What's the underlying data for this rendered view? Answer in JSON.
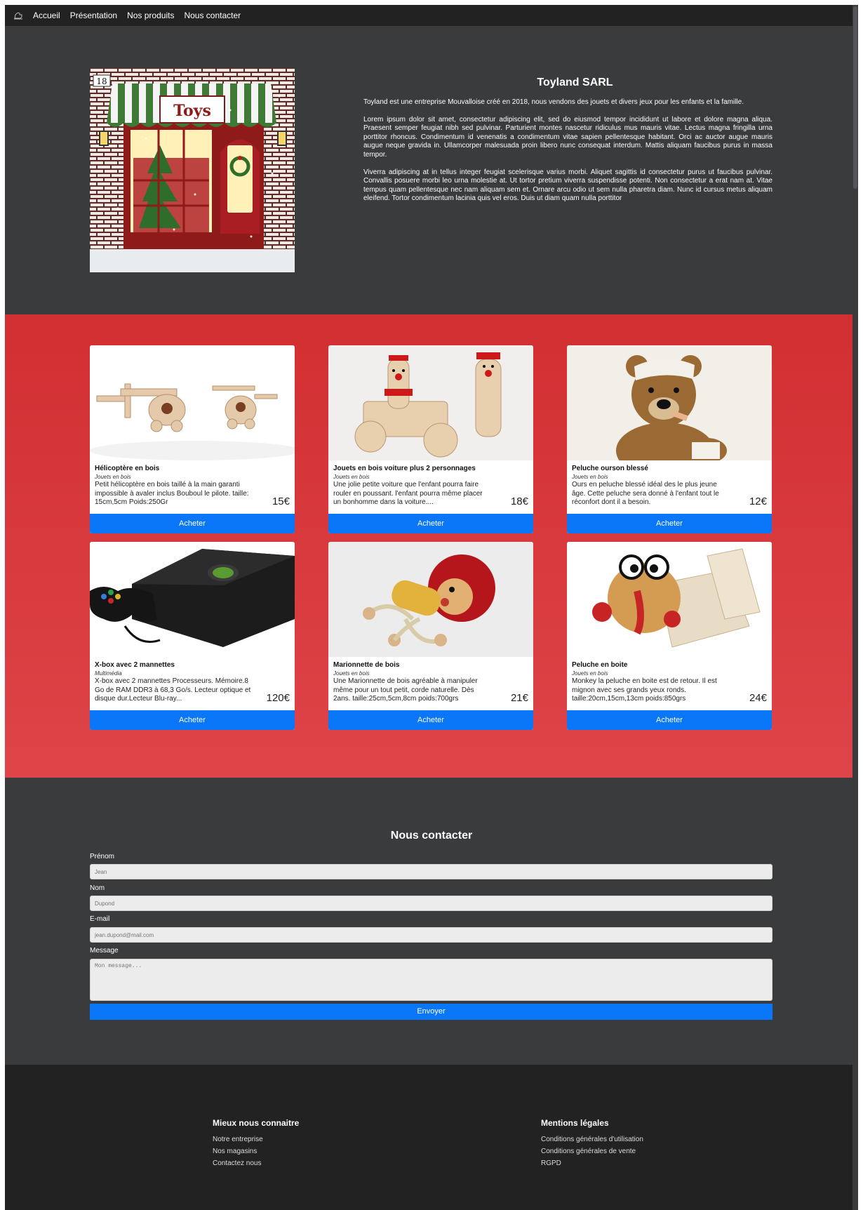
{
  "nav": {
    "logo_icon": "toy-horse-icon",
    "links": [
      "Accueil",
      "Présentation",
      "Nos produits",
      "Nous contacter"
    ]
  },
  "hero": {
    "sign_text": "Toys",
    "calendar_day": "18",
    "title": "Toyland SARL",
    "intro": "Toyland est une entreprise Mouvalloise créé en 2018, nous vendons des jouets et divers jeux pour les enfants et la famille.",
    "p1": "Lorem ipsum dolor sit amet, consectetur adipiscing elit, sed do eiusmod tempor incididunt ut labore et dolore magna aliqua. Praesent semper feugiat nibh sed pulvinar. Parturient montes nascetur ridiculus mus mauris vitae. Lectus magna fringilla urna porttitor rhoncus. Condimentum id venenatis a condimentum vitae sapien pellentesque habitant. Orci ac auctor augue mauris augue neque gravida in. Ullamcorper malesuada proin libero nunc consequat interdum. Mattis aliquam faucibus purus in massa tempor.",
    "p2": "Viverra adipiscing at in tellus integer feugiat scelerisque varius morbi. Aliquet sagittis id consectetur purus ut faucibus pulvinar. Convallis posuere morbi leo urna molestie at. Ut tortor pretium viverra suspendisse potenti. Non consectetur a erat nam at. Vitae tempus quam pellentesque nec nam aliquam sem et. Ornare arcu odio ut sem nulla pharetra diam. Nunc id cursus metus aliquam eleifend. Tortor condimentum lacinia quis vel eros. Duis ut diam quam nulla porttitor"
  },
  "products": [
    {
      "title": "Hélicoptère en bois",
      "category": "Jouets en bois",
      "desc": "Petit hélicoptère en bois taillé à la main garanti impossible à avaler inclus Bouboul le pilote. taille: 15cm,5cm Poids:250Gr",
      "price": "15€",
      "button": "Acheter"
    },
    {
      "title": "Jouets en bois voiture plus 2 personnages",
      "category": "Jouets en bois",
      "desc": "Une jolie petite voiture que l'enfant pourra faire rouler en poussant. l'enfant pourra même placer un bonhomme dans la voiture....",
      "price": "18€",
      "button": "Acheter"
    },
    {
      "title": "Peluche ourson blessé",
      "category": "Jouets en bois",
      "desc": "Ours en peluche blessé idéal des le plus jeune âge. Cette peluche sera donné à l'enfant tout le réconfort dont il a besoin.",
      "price": "12€",
      "button": "Acheter"
    },
    {
      "title": "X-box avec 2 mannettes",
      "category": "Multimédia",
      "desc": "X-box avec 2 mannettes Processeurs. Mémoire.8 Go de RAM DDR3 à 68,3 Go/s. Lecteur optique et disque dur.Lecteur Blu-ray...",
      "price": "120€",
      "button": "Acheter"
    },
    {
      "title": "Marionnette de bois",
      "category": "Jouets en bois",
      "desc": "Une Marionnette de bois agréable à manipuler même pour un tout petit, corde naturelle. Dès 2ans. taille:25cm,5cm,8cm poids:700grs",
      "price": "21€",
      "button": "Acheter"
    },
    {
      "title": "Peluche en boite",
      "category": "Jouets en bois",
      "desc": "Monkey la peluche en boite est de retour. Il est mignon avec ses grands yeux ronds. taille:20cm,15cm,13cm poids:850grs",
      "price": "24€",
      "button": "Acheter"
    }
  ],
  "contact": {
    "title": "Nous contacter",
    "firstname_label": "Prénom",
    "firstname_placeholder": "Jean",
    "lastname_label": "Nom",
    "lastname_placeholder": "Dupond",
    "email_label": "E-mail",
    "email_placeholder": "jean.dupond@mail.com",
    "message_label": "Message",
    "message_placeholder": "Mon message...",
    "submit": "Envoyer"
  },
  "footer": {
    "col1": {
      "title": "Mieux nous connaitre",
      "links": [
        "Notre entreprise",
        "Nos magasins",
        "Contactez nous"
      ]
    },
    "col2": {
      "title": "Mentions légales",
      "links": [
        "Conditions générales d'utilisation",
        "Conditions générales de vente",
        "RGPD"
      ]
    }
  },
  "colors": {
    "nav_bg": "#222223",
    "page_bg": "#3a3b3d",
    "products_red": "#d22f32",
    "button_blue": "#0a77f8"
  }
}
